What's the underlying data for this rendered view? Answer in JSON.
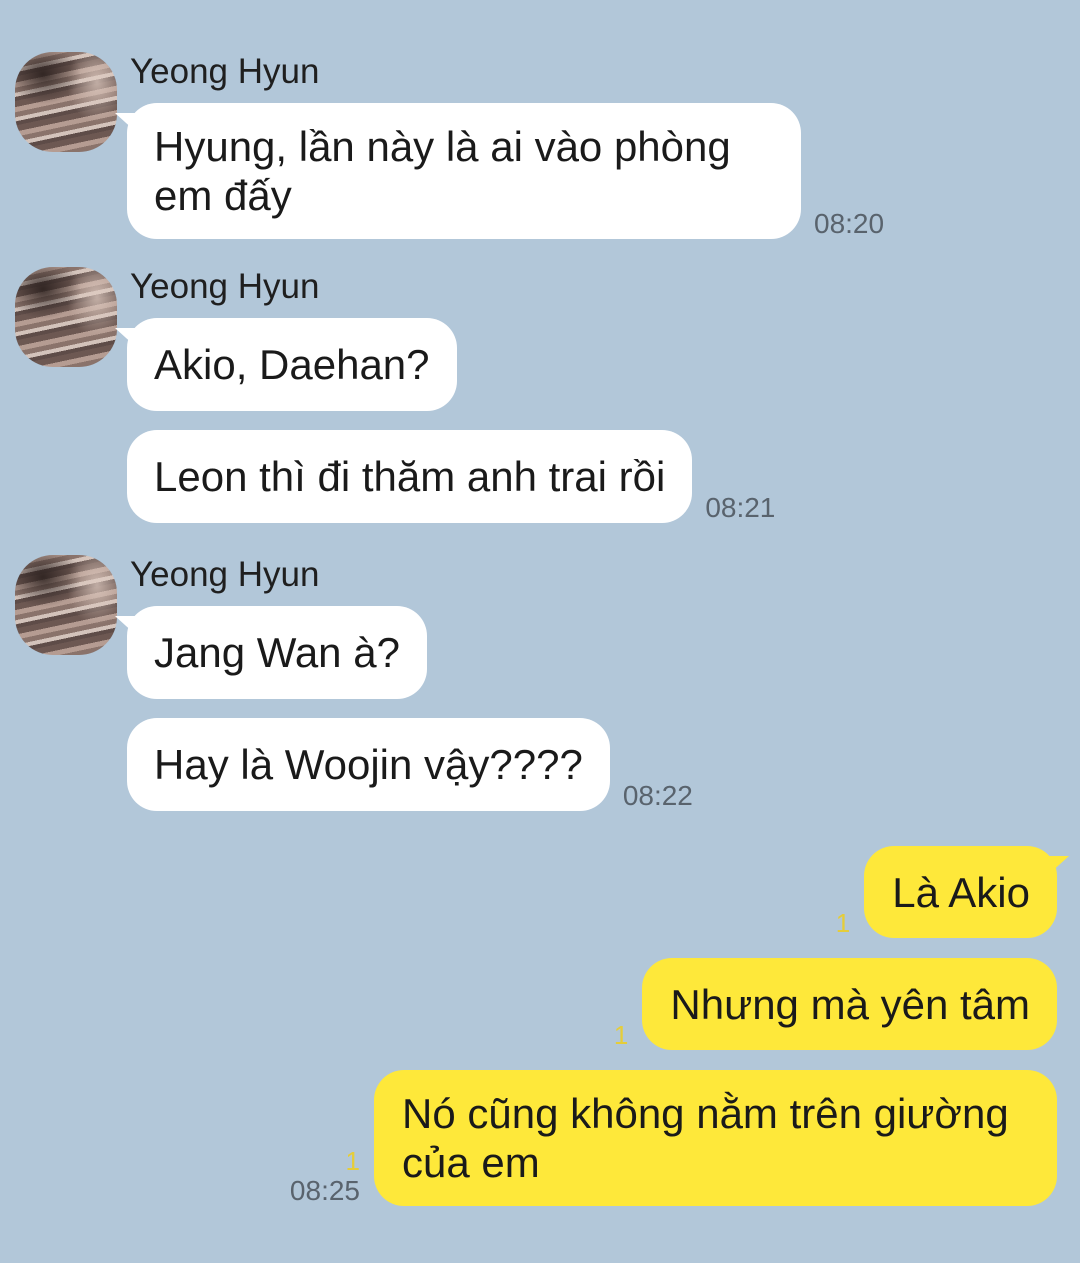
{
  "colors": {
    "background": "#b2c7d9",
    "received_bubble": "#ffffff",
    "sent_bubble": "#fee83a",
    "unread": "#e5cd3a",
    "timestamp": "#59636d"
  },
  "received_groups": [
    {
      "sender": "Yeong Hyun",
      "messages": [
        "Hyung, lần này là ai vào phòng em đấy"
      ],
      "time": "08:20"
    },
    {
      "sender": "Yeong Hyun",
      "messages": [
        "Akio, Daehan?",
        "Leon thì đi thăm anh trai rồi"
      ],
      "time": "08:21"
    },
    {
      "sender": "Yeong Hyun",
      "messages": [
        "Jang Wan à?",
        "Hay là Woojin vậy????"
      ],
      "time": "08:22"
    }
  ],
  "sent_group": {
    "messages": [
      {
        "text": "Là Akio",
        "unread": "1"
      },
      {
        "text": "Nhưng mà yên tâm",
        "unread": "1"
      },
      {
        "text": "Nó cũng không nằm trên giường của em",
        "unread": "1"
      }
    ],
    "time": "08:25"
  }
}
